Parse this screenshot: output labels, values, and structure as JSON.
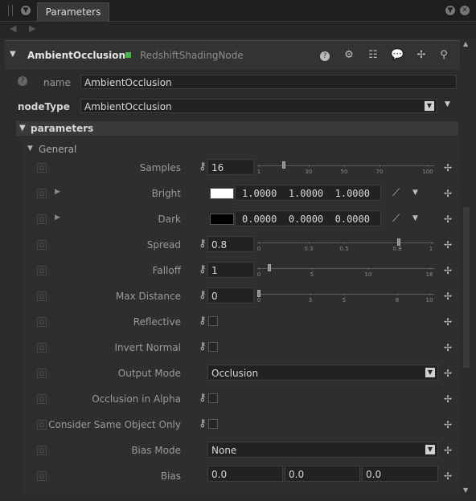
{
  "panel": {
    "tab_label": "Parameters"
  },
  "node": {
    "name": "AmbientOcclusion",
    "type": "RedshiftShadingNode"
  },
  "fields": {
    "name_label": "name",
    "name_value": "AmbientOcclusion",
    "nodetype_label": "nodeType",
    "nodetype_value": "AmbientOcclusion"
  },
  "sections": {
    "parameters": "parameters",
    "general": "General"
  },
  "params": {
    "samples": {
      "label": "Samples",
      "value": "16",
      "ticks": [
        "1",
        "30",
        "50",
        "70",
        "100"
      ]
    },
    "bright": {
      "label": "Bright",
      "r": "1.0000",
      "g": "1.0000",
      "b": "1.0000",
      "color": "#ffffff"
    },
    "dark": {
      "label": "Dark",
      "r": "0.0000",
      "g": "0.0000",
      "b": "0.0000",
      "color": "#000000"
    },
    "spread": {
      "label": "Spread",
      "value": "0.8",
      "ticks": [
        "0",
        "0.3",
        "0.5",
        "0.8",
        "1"
      ]
    },
    "falloff": {
      "label": "Falloff",
      "value": "1",
      "ticks": [
        "0",
        "5",
        "10",
        "16"
      ]
    },
    "max_distance": {
      "label": "Max Distance",
      "value": "0",
      "ticks": [
        "0",
        "3",
        "5",
        "8",
        "10"
      ]
    },
    "reflective": {
      "label": "Reflective"
    },
    "invert_normal": {
      "label": "Invert Normal"
    },
    "output_mode": {
      "label": "Output Mode",
      "value": "Occlusion"
    },
    "occlusion_alpha": {
      "label": "Occlusion in Alpha"
    },
    "same_object": {
      "label": "Consider Same Object Only"
    },
    "bias_mode": {
      "label": "Bias Mode",
      "value": "None"
    },
    "bias": {
      "label": "Bias",
      "x": "0.0",
      "y": "0.0",
      "z": "0.0"
    }
  }
}
